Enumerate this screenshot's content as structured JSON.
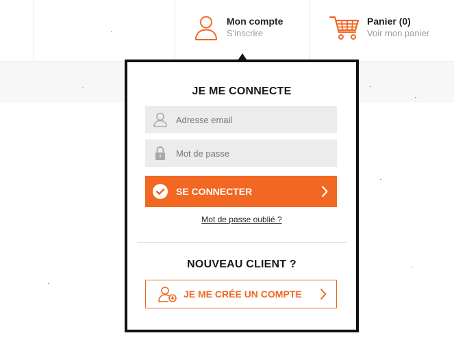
{
  "header": {
    "account": {
      "title": "Mon compte",
      "subtitle": "S'inscrire",
      "icon": "user-icon"
    },
    "cart": {
      "title": "Panier (0)",
      "subtitle": "Voir mon panier",
      "icon": "cart-icon"
    },
    "accent_color": "#f26722"
  },
  "login": {
    "heading": "JE ME CONNECTE",
    "email_placeholder": "Adresse email",
    "password_placeholder": "Mot de passe",
    "submit_label": "SE CONNECTER",
    "forgot_label": "Mot de passe oublié ?"
  },
  "signup": {
    "heading": "NOUVEAU CLIENT ?",
    "create_label": "JE ME CRÉE UN COMPTE"
  }
}
